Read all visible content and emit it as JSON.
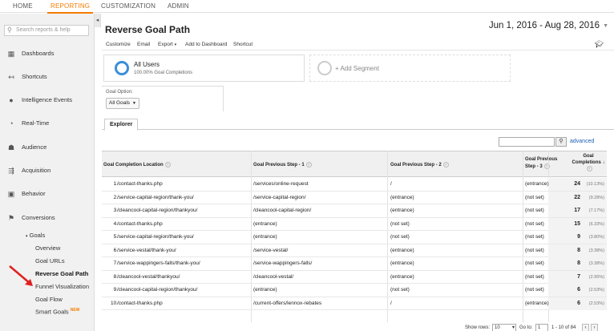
{
  "topnav": {
    "tabs": [
      {
        "label": "HOME"
      },
      {
        "label": "REPORTING"
      },
      {
        "label": "CUSTOMIZATION"
      },
      {
        "label": "ADMIN"
      }
    ],
    "active_tab": "REPORTING"
  },
  "sidebar": {
    "collapse_icon": "chevron-left-icon",
    "search_placeholder": "Search reports & help",
    "items": [
      {
        "label": "Dashboards",
        "icon": "grid-icon"
      },
      {
        "label": "Shortcuts",
        "icon": "shortcut-arrow-icon"
      },
      {
        "label": "Intelligence Events",
        "icon": "lightbulb-icon"
      },
      {
        "label": "Real-Time",
        "icon": "clock-icon"
      },
      {
        "label": "Audience",
        "icon": "people-icon"
      },
      {
        "label": "Acquisition",
        "icon": "acquisition-icon"
      },
      {
        "label": "Behavior",
        "icon": "behavior-icon"
      },
      {
        "label": "Conversions",
        "icon": "flag-icon"
      }
    ],
    "goals_group": "Goals",
    "goal_items": [
      {
        "label": "Overview"
      },
      {
        "label": "Goal URLs"
      },
      {
        "label": "Reverse Goal Path"
      },
      {
        "label": "Funnel Visualization"
      },
      {
        "label": "Goal Flow"
      },
      {
        "label": "Smart Goals",
        "badge": "NEW"
      }
    ],
    "active_goal_item": "Reverse Goal Path"
  },
  "report": {
    "title": "Reverse Goal Path",
    "date_range": "Jun 1, 2016 - Aug 28, 2016",
    "actions": [
      "Customize",
      "Email",
      "Export",
      "Add to Dashboard",
      "Shortcut"
    ],
    "segment": {
      "title": "All Users",
      "subtitle": "100.00% Goal Completions"
    },
    "add_segment": "+ Add Segment",
    "goal_option_label": "Goal Option:",
    "goal_option_value": "All Goals",
    "explorer_tab": "Explorer",
    "advanced_link": "advanced"
  },
  "table": {
    "headers": {
      "location": "Goal Completion Location",
      "step1": "Goal Previous Step - 1",
      "step2": "Goal Previous Step - 2",
      "step3_line1": "Goal Previous",
      "step3_line2": "Step - 3",
      "completions_line1": "Goal",
      "completions_line2": "Completions"
    },
    "rows": [
      {
        "n": "1.",
        "location": "/contact-thanks.php",
        "step1": "/services/online-request",
        "step2": "/",
        "step3": "(entrance)",
        "completions": "24",
        "pct": "(10.13%)"
      },
      {
        "n": "2.",
        "location": "/service-capital-region/thank-you/",
        "step1": "/service-capital-region/",
        "step2": "(entrance)",
        "step3": "(not set)",
        "completions": "22",
        "pct": "(9.28%)"
      },
      {
        "n": "3.",
        "location": "/cleancool-capital-region/thankyou/",
        "step1": "/cleancool-capital-region/",
        "step2": "(entrance)",
        "step3": "(not set)",
        "completions": "17",
        "pct": "(7.17%)"
      },
      {
        "n": "4.",
        "location": "/contact-thanks.php",
        "step1": "(entrance)",
        "step2": "(not set)",
        "step3": "(not set)",
        "completions": "15",
        "pct": "(6.33%)"
      },
      {
        "n": "5.",
        "location": "/service-capital-region/thank-you/",
        "step1": "(entrance)",
        "step2": "(not set)",
        "step3": "(not set)",
        "completions": "9",
        "pct": "(3.80%)"
      },
      {
        "n": "6.",
        "location": "/service-vestal/thank-you/",
        "step1": "/service-vestal/",
        "step2": "(entrance)",
        "step3": "(not set)",
        "completions": "8",
        "pct": "(3.38%)"
      },
      {
        "n": "7.",
        "location": "/service-wappingers-falls/thank-you/",
        "step1": "/service-wappingers-falls/",
        "step2": "(entrance)",
        "step3": "(not set)",
        "completions": "8",
        "pct": "(3.38%)"
      },
      {
        "n": "8.",
        "location": "/cleancool-vestal/thankyou/",
        "step1": "/cleancool-vestal/",
        "step2": "(entrance)",
        "step3": "(not set)",
        "completions": "7",
        "pct": "(2.95%)"
      },
      {
        "n": "9.",
        "location": "/cleancool-capital-region/thankyou/",
        "step1": "(entrance)",
        "step2": "(not set)",
        "step3": "(not set)",
        "completions": "6",
        "pct": "(2.53%)"
      },
      {
        "n": "10.",
        "location": "/contact-thanks.php",
        "step1": "/current-offers/lennox-rebates",
        "step2": "/",
        "step3": "(entrance)",
        "completions": "6",
        "pct": "(2.53%)"
      }
    ],
    "footer": {
      "show_rows_label": "Show rows:",
      "show_rows_value": "10",
      "goto_label": "Go to:",
      "goto_value": "1",
      "range": "1 - 10 of 84"
    }
  },
  "colors": {
    "accent": "#f57c00",
    "link": "#1a5fb4",
    "segment_ring": "#3b8ed8",
    "annotation_arrow": "#e02020"
  }
}
